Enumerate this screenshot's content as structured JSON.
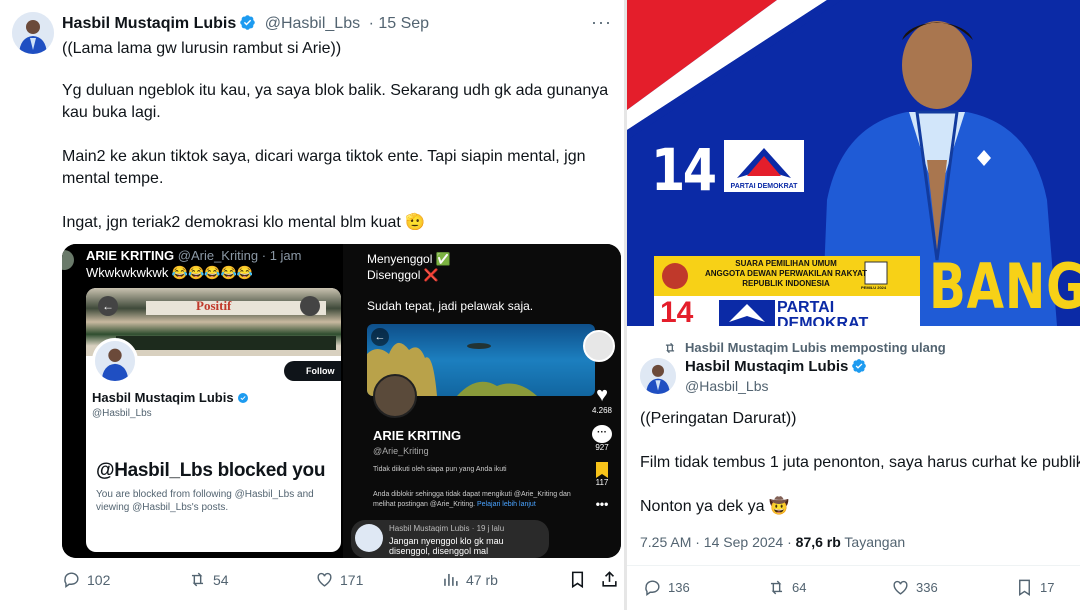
{
  "left_tweet": {
    "author_name": "Hasbil Mustaqim Lubis",
    "author_handle": "@Hasbil_Lbs",
    "date": "· 15 Sep",
    "more": "···",
    "text": [
      "((Lama lama gw lurusin rambut si Arie))",
      "Yg duluan ngeblok itu kau, ya saya blok balik. Sekarang udh gk ada gunanya kau buka lagi.",
      "Main2 ke akun tiktok saya, dicari warga tiktok ente. Tapi siapin mental, jgn mental tempe.",
      "Ingat, jgn teriak2 demokrasi klo mental blm kuat 🫡"
    ],
    "stats": {
      "replies": "102",
      "reposts": "54",
      "likes": "171",
      "views": "47 rb"
    }
  },
  "media_left": {
    "quoted_name": "ARIE KRITING",
    "quoted_handle": "@Arie_Kriting · 1 jam",
    "quoted_text": "Wkwkwkwkwk 😂😂😂😂😂",
    "book_text": "Positif",
    "follow": "Follow",
    "profile_name": "Hasbil Mustaqim Lubis",
    "profile_handle": "@Hasbil_Lbs",
    "blocked_title": "@Hasbil_Lbs blocked you",
    "blocked_desc": "You are blocked from following @Hasbil_Lbs and viewing @Hasbil_Lbs's posts."
  },
  "media_right": {
    "line1": "Menyenggol ✅",
    "line2": "Disenggol ❌",
    "line3": "Sudah tepat, jadi pelawak saja.",
    "profile_name": "ARIE KRITING",
    "profile_handle": "@Arie_Kriting",
    "notice1": "Tidak diikuti oleh siapa pun yang Anda ikuti",
    "notice2": "Anda diblokir sehingga tidak dapat mengikuti @Arie_Kriting dan melihat postingan @Arie_Kriting.",
    "learn_more": "Pelajari lebih lanjut",
    "likes": "4.268",
    "comments": "927",
    "saves": "117",
    "comment_author": "Hasbil Mustaqim Lubis · 19 j lalu",
    "comment_text": "Jangan nyenggol klo gk mau disenggol, disenggol mal"
  },
  "banner": {
    "number": "14",
    "party": "PARTAI DEMOKRAT",
    "kpu_line1": "SUARA PEMILIHAN UMUM",
    "kpu_line2": "ANGGOTA DEWAN PERWAKILAN RAKYAT",
    "kpu_line3": "REPUBLIK INDONESIA",
    "pemilu": "PEMILU 2024",
    "bottom_number": "14",
    "bottom_party_1": "PARTAI",
    "bottom_party_2": "DEMOKRAT",
    "bang": "BANG"
  },
  "right_tweet": {
    "repost_line": "Hasbil Mustaqim Lubis memposting ulang",
    "author_name": "Hasbil Mustaqim Lubis",
    "author_handle": "@Hasbil_Lbs",
    "text": [
      "((Peringatan Darurat))",
      "Film tidak tembus 1 juta penonton, saya harus curhat ke publik",
      "Nonton ya dek ya 🤠"
    ],
    "time": "7.25 AM · 14 Sep 2024 · ",
    "views": "87,6 rb",
    "views_label": " Tayangan",
    "stats": {
      "replies": "136",
      "reposts": "64",
      "likes": "336",
      "bookmarks": "17"
    }
  },
  "colors": {
    "blue": "#0b2aa6",
    "verified": "#1d9bf0",
    "muted": "#536471",
    "yellow": "#f7d117"
  }
}
